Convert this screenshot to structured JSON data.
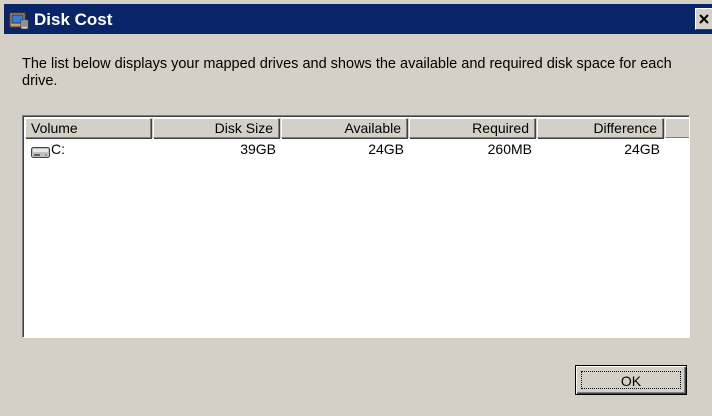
{
  "window": {
    "title": "Disk Cost",
    "icon": "installer-package-icon",
    "close_glyph": "✕"
  },
  "description": "The list below displays your mapped drives and shows the available and required disk space for each drive.",
  "list": {
    "columns": [
      "Volume",
      "Disk Size",
      "Available",
      "Required",
      "Difference"
    ],
    "rows": [
      {
        "icon": "drive-icon",
        "volume": "C:",
        "disk_size": "39GB",
        "available": "24GB",
        "required": "260MB",
        "difference": "24GB"
      }
    ]
  },
  "buttons": {
    "ok_label": "OK"
  },
  "colors": {
    "titlebar": "#0a246a",
    "face": "#d4d0c8"
  }
}
